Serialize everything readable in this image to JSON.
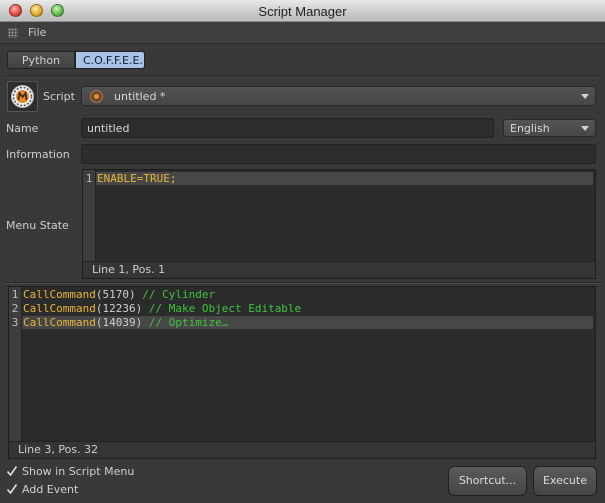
{
  "window": {
    "title": "Script Manager"
  },
  "menubar": {
    "items": [
      "File"
    ]
  },
  "tabs": [
    {
      "label": "Python"
    },
    {
      "label": "C.O.F.F.E.E."
    }
  ],
  "script": {
    "label": "Script",
    "selected": "untitled *"
  },
  "name": {
    "label": "Name",
    "value": "untitled"
  },
  "language": {
    "value": "English"
  },
  "information": {
    "label": "Information",
    "value": ""
  },
  "menu_state": {
    "label": "Menu State",
    "lines": [
      {
        "num": "1",
        "text": "ENABLE=TRUE;"
      }
    ],
    "status": "Line 1, Pos. 1"
  },
  "code_editor": {
    "lines": [
      {
        "num": "1",
        "func": "CallCommand",
        "open": "(",
        "arg": "5170",
        "close": ")",
        "comment": "// Cylinder"
      },
      {
        "num": "2",
        "func": "CallCommand",
        "open": "(",
        "arg": "12236",
        "close": ")",
        "comment": "// Make Object Editable"
      },
      {
        "num": "3",
        "func": "CallCommand",
        "open": "(",
        "arg": "14039",
        "close": ")",
        "comment": "// Optimize…"
      }
    ],
    "status": "Line 3, Pos. 32"
  },
  "options": {
    "show_in_menu": {
      "label": "Show in Script Menu",
      "checked": true
    },
    "add_event": {
      "label": "Add Event",
      "checked": true
    }
  },
  "buttons": {
    "shortcut": "Shortcut...",
    "execute": "Execute"
  },
  "colors": {
    "selected_tab": "#a8c3e6",
    "keyword": "#e8b53a",
    "comment": "#3ec43e",
    "background": "#393939"
  }
}
